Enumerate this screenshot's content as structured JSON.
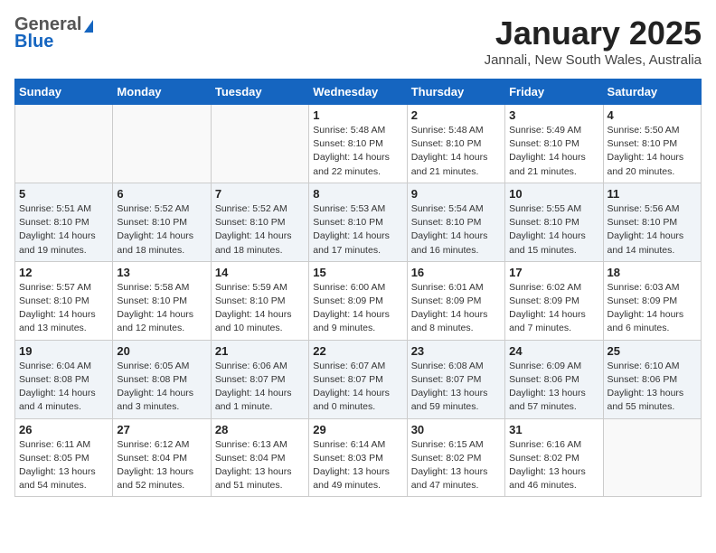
{
  "header": {
    "logo_general": "General",
    "logo_blue": "Blue",
    "month_title": "January 2025",
    "location": "Jannali, New South Wales, Australia"
  },
  "days_of_week": [
    "Sunday",
    "Monday",
    "Tuesday",
    "Wednesday",
    "Thursday",
    "Friday",
    "Saturday"
  ],
  "weeks": [
    [
      {
        "day": "",
        "info": ""
      },
      {
        "day": "",
        "info": ""
      },
      {
        "day": "",
        "info": ""
      },
      {
        "day": "1",
        "info": "Sunrise: 5:48 AM\nSunset: 8:10 PM\nDaylight: 14 hours\nand 22 minutes."
      },
      {
        "day": "2",
        "info": "Sunrise: 5:48 AM\nSunset: 8:10 PM\nDaylight: 14 hours\nand 21 minutes."
      },
      {
        "day": "3",
        "info": "Sunrise: 5:49 AM\nSunset: 8:10 PM\nDaylight: 14 hours\nand 21 minutes."
      },
      {
        "day": "4",
        "info": "Sunrise: 5:50 AM\nSunset: 8:10 PM\nDaylight: 14 hours\nand 20 minutes."
      }
    ],
    [
      {
        "day": "5",
        "info": "Sunrise: 5:51 AM\nSunset: 8:10 PM\nDaylight: 14 hours\nand 19 minutes."
      },
      {
        "day": "6",
        "info": "Sunrise: 5:52 AM\nSunset: 8:10 PM\nDaylight: 14 hours\nand 18 minutes."
      },
      {
        "day": "7",
        "info": "Sunrise: 5:52 AM\nSunset: 8:10 PM\nDaylight: 14 hours\nand 18 minutes."
      },
      {
        "day": "8",
        "info": "Sunrise: 5:53 AM\nSunset: 8:10 PM\nDaylight: 14 hours\nand 17 minutes."
      },
      {
        "day": "9",
        "info": "Sunrise: 5:54 AM\nSunset: 8:10 PM\nDaylight: 14 hours\nand 16 minutes."
      },
      {
        "day": "10",
        "info": "Sunrise: 5:55 AM\nSunset: 8:10 PM\nDaylight: 14 hours\nand 15 minutes."
      },
      {
        "day": "11",
        "info": "Sunrise: 5:56 AM\nSunset: 8:10 PM\nDaylight: 14 hours\nand 14 minutes."
      }
    ],
    [
      {
        "day": "12",
        "info": "Sunrise: 5:57 AM\nSunset: 8:10 PM\nDaylight: 14 hours\nand 13 minutes."
      },
      {
        "day": "13",
        "info": "Sunrise: 5:58 AM\nSunset: 8:10 PM\nDaylight: 14 hours\nand 12 minutes."
      },
      {
        "day": "14",
        "info": "Sunrise: 5:59 AM\nSunset: 8:10 PM\nDaylight: 14 hours\nand 10 minutes."
      },
      {
        "day": "15",
        "info": "Sunrise: 6:00 AM\nSunset: 8:09 PM\nDaylight: 14 hours\nand 9 minutes."
      },
      {
        "day": "16",
        "info": "Sunrise: 6:01 AM\nSunset: 8:09 PM\nDaylight: 14 hours\nand 8 minutes."
      },
      {
        "day": "17",
        "info": "Sunrise: 6:02 AM\nSunset: 8:09 PM\nDaylight: 14 hours\nand 7 minutes."
      },
      {
        "day": "18",
        "info": "Sunrise: 6:03 AM\nSunset: 8:09 PM\nDaylight: 14 hours\nand 6 minutes."
      }
    ],
    [
      {
        "day": "19",
        "info": "Sunrise: 6:04 AM\nSunset: 8:08 PM\nDaylight: 14 hours\nand 4 minutes."
      },
      {
        "day": "20",
        "info": "Sunrise: 6:05 AM\nSunset: 8:08 PM\nDaylight: 14 hours\nand 3 minutes."
      },
      {
        "day": "21",
        "info": "Sunrise: 6:06 AM\nSunset: 8:07 PM\nDaylight: 14 hours\nand 1 minute."
      },
      {
        "day": "22",
        "info": "Sunrise: 6:07 AM\nSunset: 8:07 PM\nDaylight: 14 hours\nand 0 minutes."
      },
      {
        "day": "23",
        "info": "Sunrise: 6:08 AM\nSunset: 8:07 PM\nDaylight: 13 hours\nand 59 minutes."
      },
      {
        "day": "24",
        "info": "Sunrise: 6:09 AM\nSunset: 8:06 PM\nDaylight: 13 hours\nand 57 minutes."
      },
      {
        "day": "25",
        "info": "Sunrise: 6:10 AM\nSunset: 8:06 PM\nDaylight: 13 hours\nand 55 minutes."
      }
    ],
    [
      {
        "day": "26",
        "info": "Sunrise: 6:11 AM\nSunset: 8:05 PM\nDaylight: 13 hours\nand 54 minutes."
      },
      {
        "day": "27",
        "info": "Sunrise: 6:12 AM\nSunset: 8:04 PM\nDaylight: 13 hours\nand 52 minutes."
      },
      {
        "day": "28",
        "info": "Sunrise: 6:13 AM\nSunset: 8:04 PM\nDaylight: 13 hours\nand 51 minutes."
      },
      {
        "day": "29",
        "info": "Sunrise: 6:14 AM\nSunset: 8:03 PM\nDaylight: 13 hours\nand 49 minutes."
      },
      {
        "day": "30",
        "info": "Sunrise: 6:15 AM\nSunset: 8:02 PM\nDaylight: 13 hours\nand 47 minutes."
      },
      {
        "day": "31",
        "info": "Sunrise: 6:16 AM\nSunset: 8:02 PM\nDaylight: 13 hours\nand 46 minutes."
      },
      {
        "day": "",
        "info": ""
      }
    ]
  ]
}
